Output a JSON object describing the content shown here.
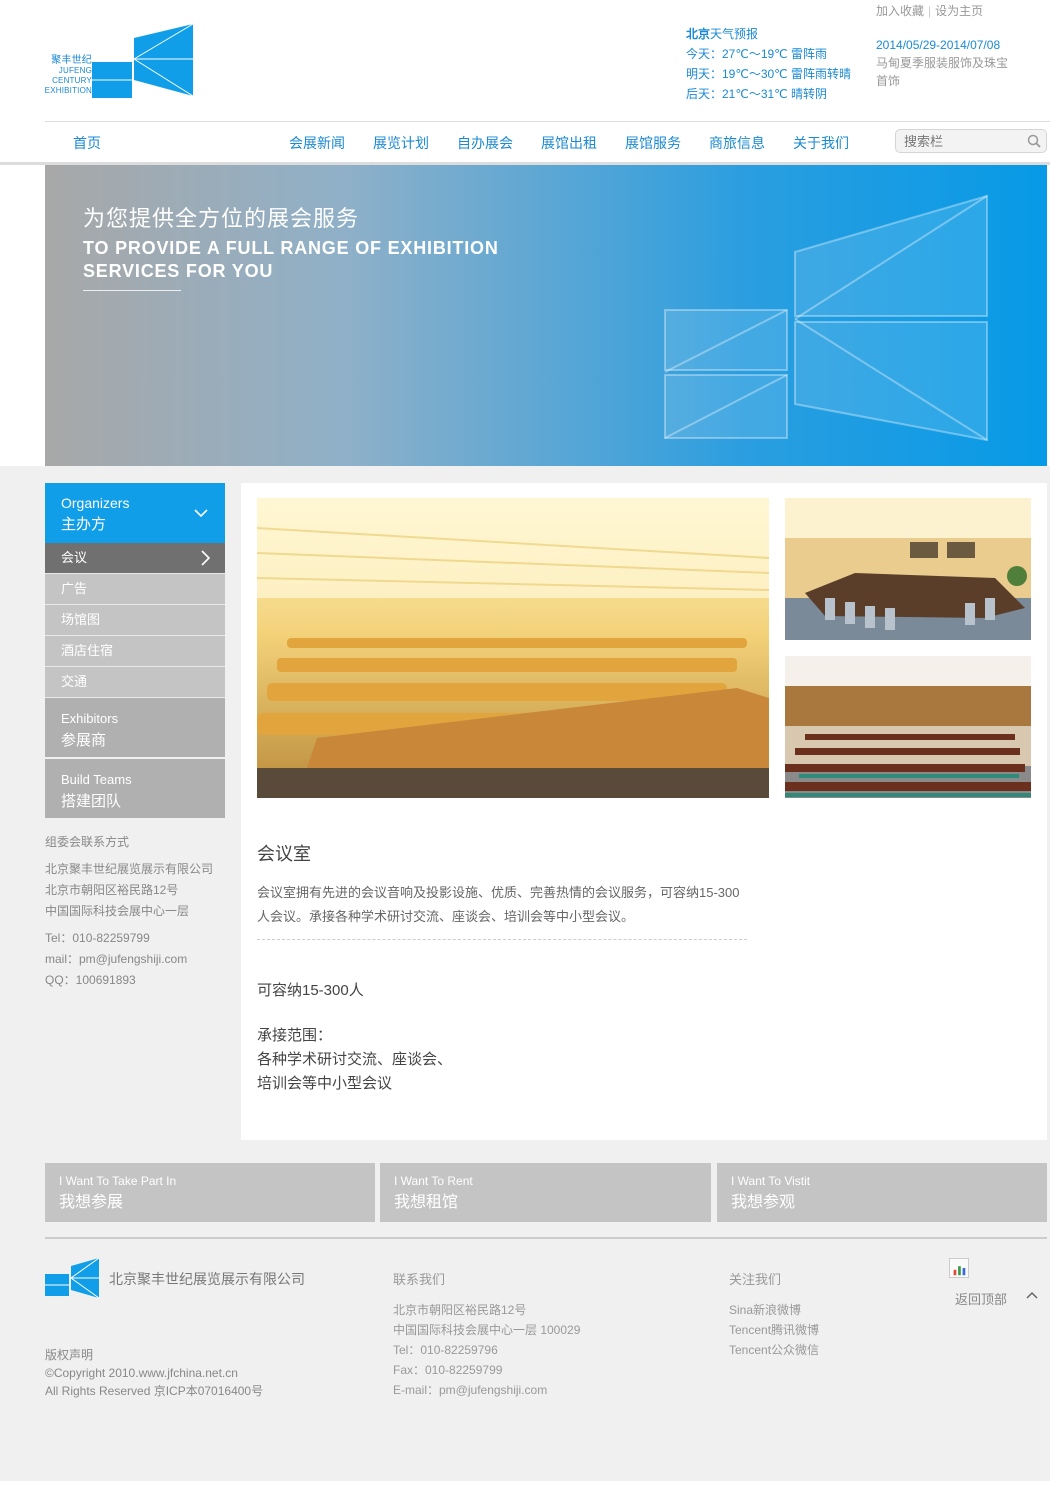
{
  "brand": {
    "logo_cn": "聚丰世纪",
    "logo_en1": "JUFENG",
    "logo_en2": "CENTURY",
    "logo_en3": "EXHIBITION",
    "color": "#119ee9"
  },
  "header": {
    "weather_title_bold": "北京",
    "weather_title": "天气预报",
    "weather_today": "今天：27℃～19℃ 雷阵雨",
    "weather_tomorrow": "明天：19℃～30℃ 雷阵雨转晴",
    "weather_after": "后天：21℃～31℃ 晴转阴",
    "link_favorite": "加入收藏",
    "link_sep": "|",
    "link_homepage": "设为主页",
    "event_date": "2014/05/29-2014/07/08",
    "event_desc": "马甸夏季服装服饰及珠宝首饰"
  },
  "nav": {
    "home": "首页",
    "items": [
      "会展新闻",
      "展览计划",
      "自办展会",
      "展馆出租",
      "展馆服务",
      "商旅信息",
      "关于我们"
    ],
    "search_placeholder": "搜索栏"
  },
  "banner": {
    "title_cn": "为您提供全方位的展会服务",
    "title_en": "TO PROVIDE  A FULL RANGE OF EXHIBITION SERVICES FOR YOU"
  },
  "sidebar": {
    "head_en": "Organizers",
    "head_cn": "主办方",
    "items": [
      "会议",
      "广告",
      "场馆图",
      "酒店住宿",
      "交通"
    ],
    "exhibitors_en": "Exhibitors",
    "exhibitors_cn": "参展商",
    "build_en": "Build Teams",
    "build_cn": "搭建团队",
    "contact_title": "组委会联系方式",
    "contact_company": "北京聚丰世纪展览展示有限公司",
    "contact_addr1": "北京市朝阳区裕民路12号",
    "contact_addr2": "中国国际科技会展中心一层",
    "contact_tel": "Tel：010-82259799",
    "contact_mail": "mail：pm@jufengshiji.com",
    "contact_qq": "QQ：100691893"
  },
  "content": {
    "title": "会议室",
    "desc": "会议室拥有先进的会议音响及投影设施、优质、完善热情的会议服务，可容纳15-300人会议。承接各种学术研讨交流、座谈会、培训会等中小型会议。",
    "capacity": "可容纳15-300人",
    "scope_label": "承接范围：",
    "scope_line1": "各种学术研讨交流、座谈会、",
    "scope_line2": "培训会等中小型会议"
  },
  "actions": [
    {
      "en": "I Want To Take Part In",
      "cn": "我想参展"
    },
    {
      "en": "I Want To Rent",
      "cn": "我想租馆"
    },
    {
      "en": "I Want To Vistit",
      "cn": "我想参观"
    }
  ],
  "footer": {
    "company": "北京聚丰世纪展览展示有限公司",
    "copyright_title": "版权声明",
    "copyright_line1": "©Copyright 2010.www.jfchina.net.cn",
    "copyright_line2": "All Rights Reserved 京ICP本07016400号",
    "contact_title": "联系我们",
    "contact_addr1": "北京市朝阳区裕民路12号",
    "contact_addr2": "中国国际科技会展中心一层 100029",
    "contact_tel": "Tel：010-82259796",
    "contact_fax": "Fax：010-82259799",
    "contact_email": "E-mail：pm@jufengshiji.com",
    "follow_title": "关注我们",
    "follow_sina": "Sina新浪微博",
    "follow_tencent": "Tencent腾讯微博",
    "follow_wechat": "Tencent公众微信",
    "back_top": "返回顶部"
  }
}
